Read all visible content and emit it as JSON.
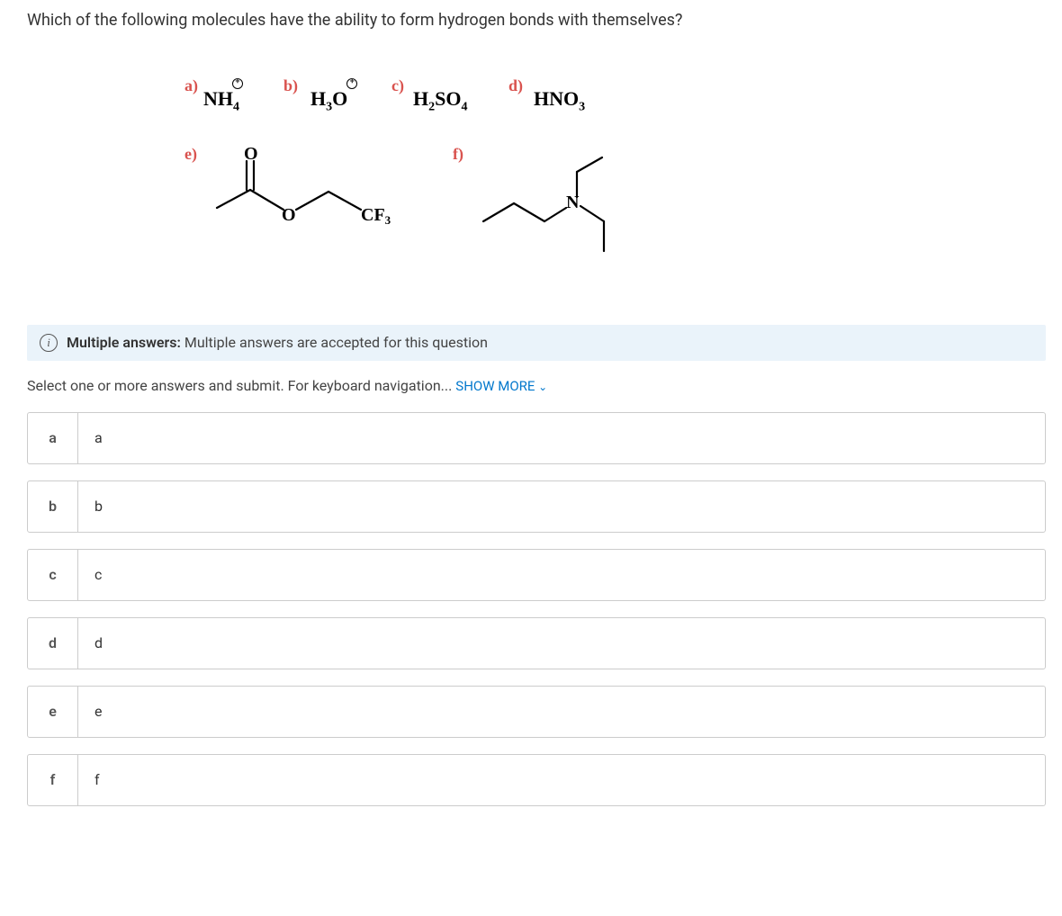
{
  "question": "Which of the following molecules have the ability to form hydrogen bonds with themselves?",
  "molecules": {
    "a": {
      "label": "a)",
      "formula_parts": [
        "NH",
        "4"
      ],
      "charge": "+"
    },
    "b": {
      "label": "b)",
      "formula_parts": [
        "H",
        "3",
        "O"
      ],
      "charge": "+"
    },
    "c": {
      "label": "c)",
      "formula_parts": [
        "H",
        "2",
        "SO",
        "4"
      ]
    },
    "d": {
      "label": "d)",
      "formula_parts": [
        "HNO",
        "3"
      ]
    },
    "e": {
      "label": "e)",
      "description": "ester with CF3 group"
    },
    "f": {
      "label": "f)",
      "description": "tertiary amine"
    }
  },
  "info": {
    "strong": "Multiple answers:",
    "text": " Multiple answers are accepted for this question"
  },
  "instruction": "Select one or more answers and submit. For keyboard navigation... ",
  "show_more": "SHOW MORE",
  "options": [
    {
      "key": "a",
      "value": "a"
    },
    {
      "key": "b",
      "value": "b"
    },
    {
      "key": "c",
      "value": "c"
    },
    {
      "key": "d",
      "value": "d"
    },
    {
      "key": "e",
      "value": "e"
    },
    {
      "key": "f",
      "value": "f"
    }
  ]
}
